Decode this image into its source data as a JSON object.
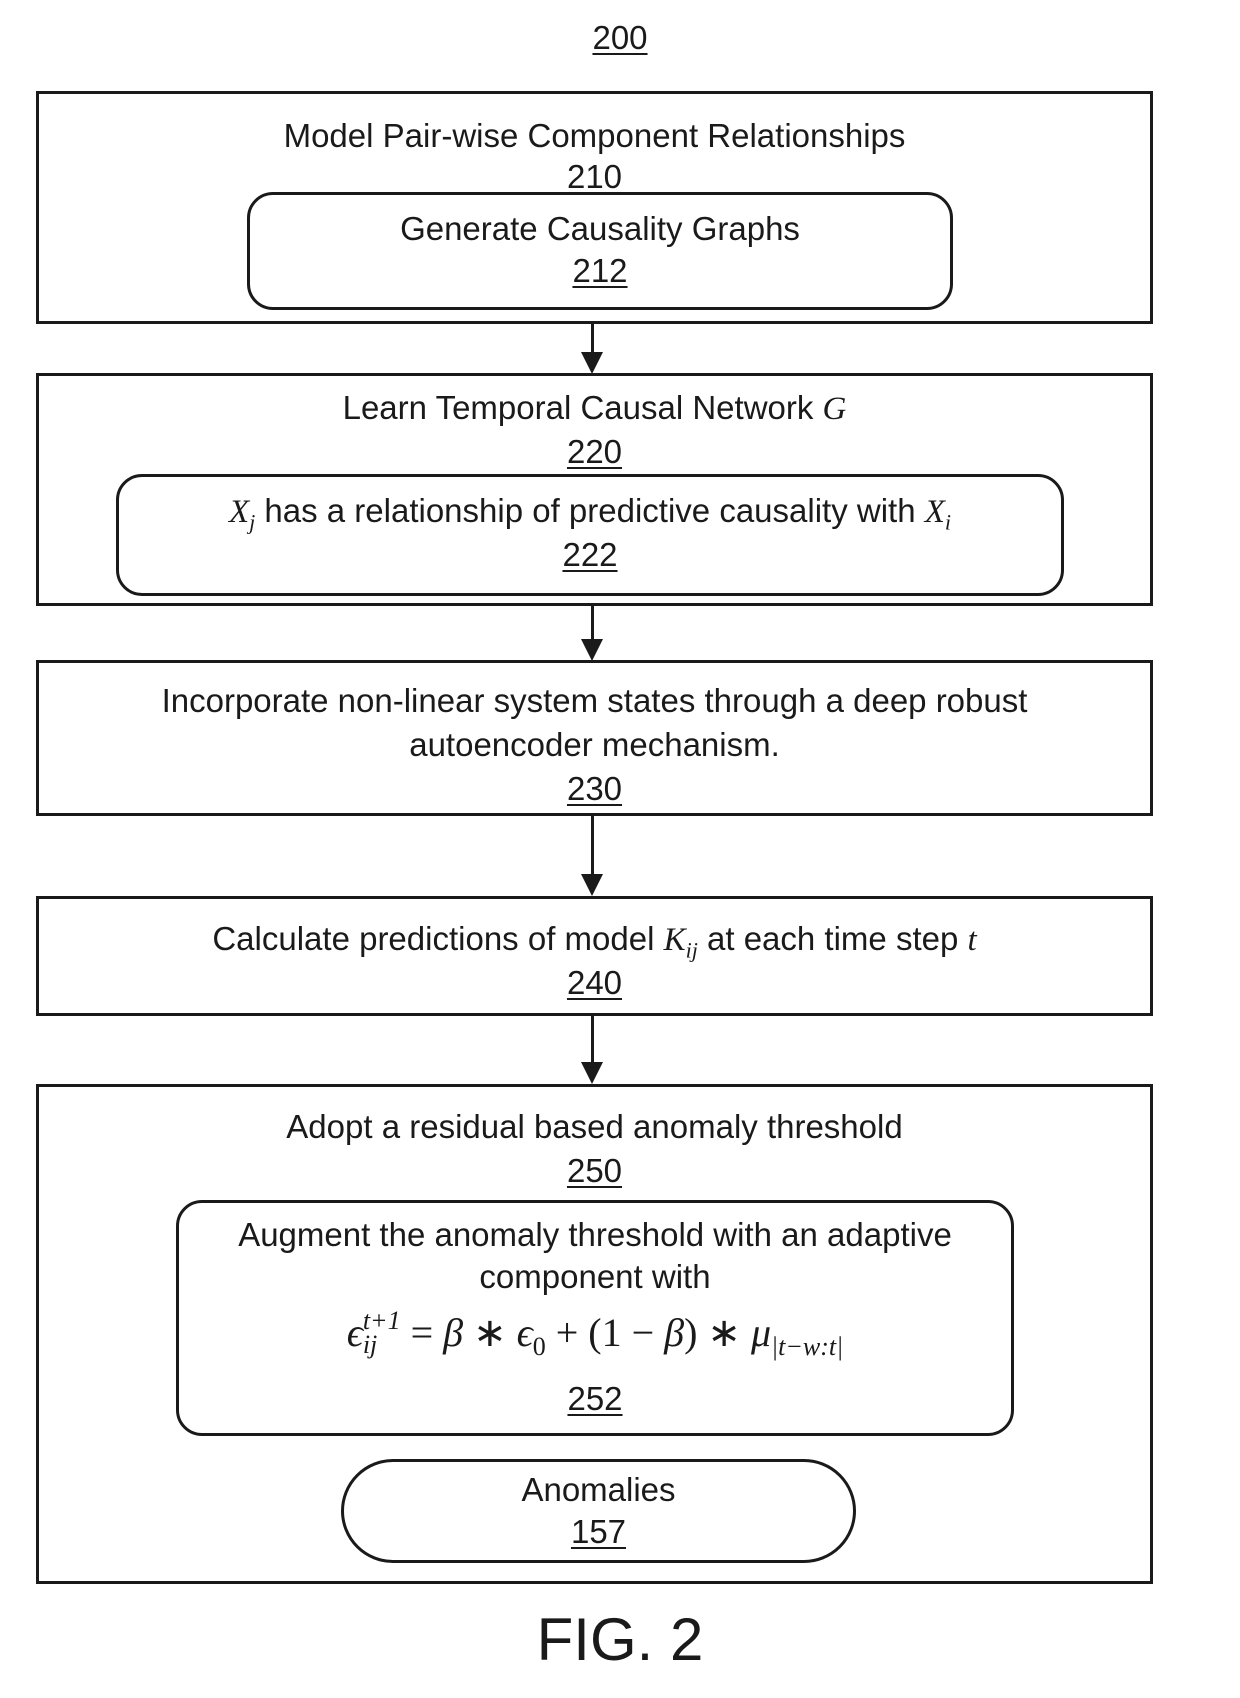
{
  "figure_number": "200",
  "caption": "FIG. 2",
  "steps": [
    {
      "title": "Model Pair-wise Component Relationships",
      "ref": "210",
      "sub": {
        "text": "Generate Causality Graphs",
        "ref": "212"
      }
    },
    {
      "title_prefix": "Learn Temporal Causal Network ",
      "title_var": "G",
      "ref": "220",
      "sub": {
        "var1": "X",
        "var1_sub": "j",
        "text": " has a relationship of predictive causality with ",
        "var2": "X",
        "var2_sub": "i",
        "ref": "222"
      }
    },
    {
      "line1": "Incorporate non-linear system states through a deep robust",
      "line2": "autoencoder mechanism.",
      "ref": "230"
    },
    {
      "text_prefix": "Calculate predictions of model ",
      "var": "K",
      "var_sub": "ij",
      "text_mid": " at each time step ",
      "var2": "t",
      "ref": "240"
    },
    {
      "title": "Adopt a residual based anomaly threshold",
      "ref": "250",
      "sub": {
        "line1": "Augment the anomaly threshold with an adaptive",
        "line2": "component with",
        "formula": {
          "lhs": "ϵ",
          "lhs_sup": "t+1",
          "lhs_sub": "ij",
          "eq": " = ",
          "beta": "β",
          "times1": " ∗ ",
          "eps0": "ϵ",
          "eps0_sub": "0",
          "plus": " + ",
          "paren": "(1 − ",
          "beta2": "β",
          "paren_close": ")",
          "times2": " ∗ ",
          "mu": "μ",
          "mu_sub": "|t−w:t|"
        },
        "ref": "252"
      },
      "output": {
        "text": "Anomalies",
        "ref": "157"
      }
    }
  ]
}
